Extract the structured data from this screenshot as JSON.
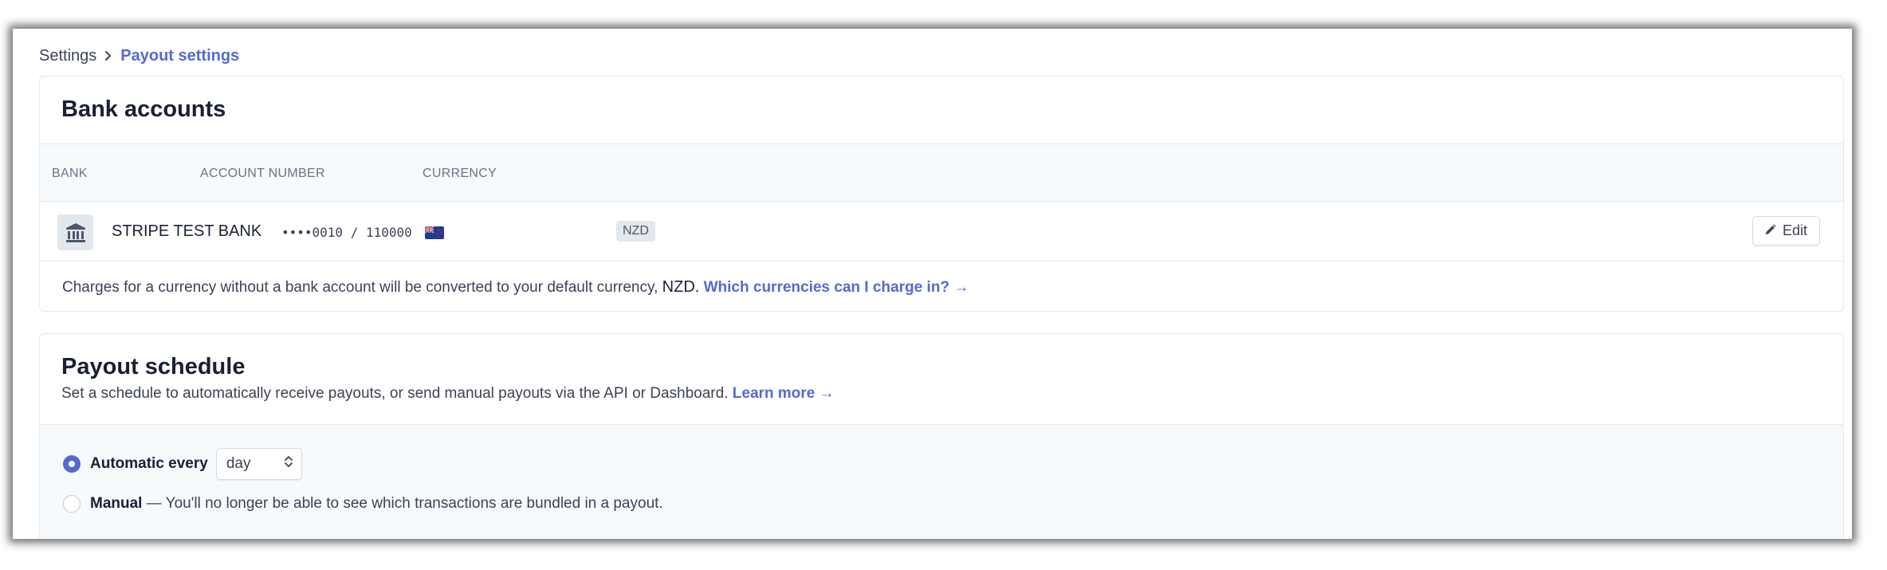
{
  "breadcrumb": {
    "parent": "Settings",
    "current": "Payout settings"
  },
  "bank_accounts": {
    "title": "Bank accounts",
    "columns": [
      "BANK",
      "ACCOUNT NUMBER",
      "CURRENCY"
    ],
    "rows": [
      {
        "bank": "STRIPE TEST BANK",
        "account_number": "••••0010 / 110000",
        "currency": "NZD",
        "flag_icon": "new-zealand-flag-icon",
        "edit_label": "Edit"
      }
    ],
    "note_prefix": "Charges for a currency without a bank account will be converted to your default currency,",
    "note_currency": "NZD.",
    "note_link": "Which currencies can I charge in? →"
  },
  "payout_schedule": {
    "title": "Payout schedule",
    "subtitle": "Set a schedule to automatically receive payouts, or send manual payouts via the API or Dashboard.",
    "subtitle_link": "Learn more →",
    "automatic_label": "Automatic every",
    "interval_value": "day",
    "manual_label": "Manual",
    "manual_desc": "— You'll no longer be able to see which transactions are bundled in a payout.",
    "selected": "automatic"
  },
  "colors": {
    "accent": "#5469d4",
    "text": "#1a1f36",
    "muted": "#697386",
    "border": "#e3e8ee",
    "table_header_bg": "#f7fafc"
  }
}
